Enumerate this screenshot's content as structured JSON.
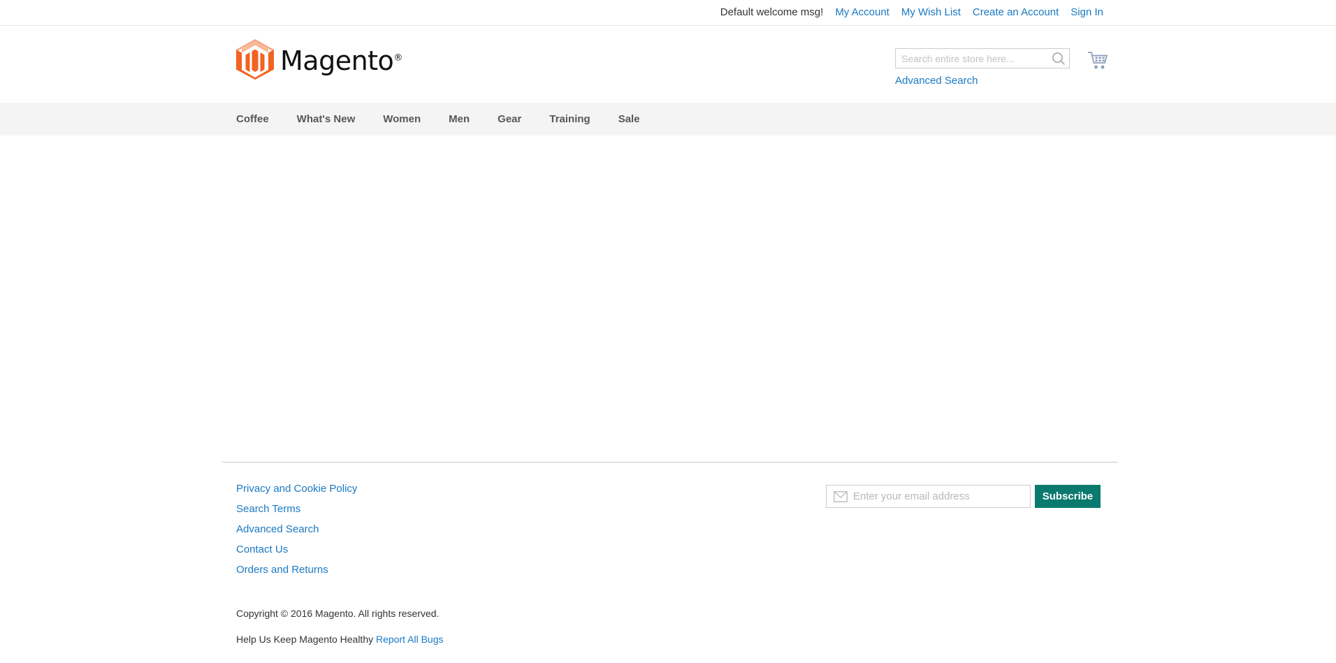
{
  "top_panel": {
    "welcome_message": "Default welcome msg!",
    "links": [
      {
        "label": "My Account",
        "name": "my-account-link"
      },
      {
        "label": "My Wish List",
        "name": "my-wish-list-link"
      },
      {
        "label": "Create an Account",
        "name": "create-account-link"
      },
      {
        "label": "Sign In",
        "name": "sign-in-link"
      }
    ]
  },
  "header": {
    "logo_text": "Magento",
    "logo_registered_mark": "®",
    "search": {
      "placeholder": "Search entire store here...",
      "value": "",
      "icon": "search-icon"
    },
    "advanced_search_label": "Advanced Search",
    "cart_icon": "shopping-cart-icon"
  },
  "nav": {
    "items": [
      {
        "label": "Coffee"
      },
      {
        "label": "What's New"
      },
      {
        "label": "Women"
      },
      {
        "label": "Men"
      },
      {
        "label": "Gear"
      },
      {
        "label": "Training"
      },
      {
        "label": "Sale"
      }
    ]
  },
  "footer": {
    "links": [
      {
        "label": "Privacy and Cookie Policy"
      },
      {
        "label": "Search Terms"
      },
      {
        "label": "Advanced Search"
      },
      {
        "label": "Contact Us"
      },
      {
        "label": "Orders and Returns"
      }
    ],
    "newsletter": {
      "placeholder": "Enter your email address",
      "value": "",
      "icon": "envelope-icon",
      "subscribe_label": "Subscribe"
    },
    "copyright": "Copyright © 2016 Magento. All rights reserved.",
    "bug_text": "Help Us Keep Magento Healthy ",
    "bug_link_label": "Report All Bugs"
  },
  "colors": {
    "link_blue": "#1979c3",
    "brand_orange": "#f26322",
    "brand_orange_light": "#f7a685",
    "subscribe_teal": "#0a7a6e",
    "nav_bg": "#f4f4f4",
    "text_dark": "#333333"
  }
}
